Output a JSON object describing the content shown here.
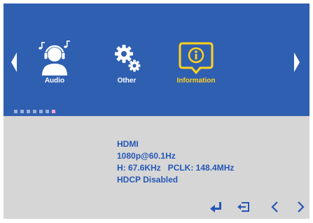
{
  "menu": {
    "items": [
      {
        "label": "Audio",
        "icon": "headphones-person-icon",
        "selected": false
      },
      {
        "label": "Other",
        "icon": "gears-icon",
        "selected": false
      },
      {
        "label": "Information",
        "icon": "info-icon",
        "selected": true
      }
    ],
    "page_dots": {
      "count": 7,
      "active_index": 6
    }
  },
  "info": {
    "input": "HDMI",
    "resolution": "1080p@60.1Hz",
    "timing": "H: 67.6KHz   PCLK: 148.4MHz",
    "hdcp": "HDCP Disabled"
  },
  "colors": {
    "header_bg": "#2f5fb1",
    "panel_bg": "#d6d6d6",
    "info_text": "#2457b5",
    "selected_label": "#ffd21f"
  },
  "controls": [
    "enter-icon",
    "exit-icon",
    "arrow-left-icon",
    "arrow-right-icon"
  ]
}
